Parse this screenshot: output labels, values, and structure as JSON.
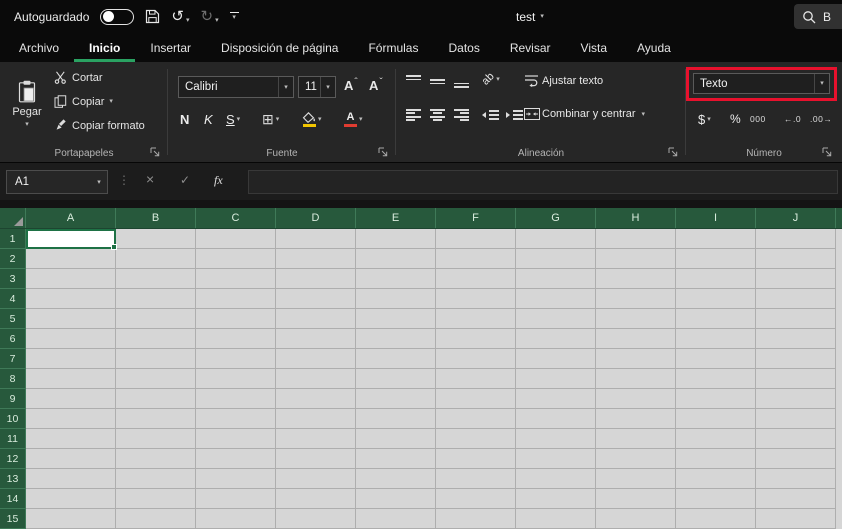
{
  "title_bar": {
    "autosave_label": "Autoguardado",
    "doc_title": "test",
    "search_text": "B"
  },
  "tabs": [
    {
      "label": "Archivo",
      "active": false
    },
    {
      "label": "Inicio",
      "active": true
    },
    {
      "label": "Insertar",
      "active": false
    },
    {
      "label": "Disposición de página",
      "active": false
    },
    {
      "label": "Fórmulas",
      "active": false
    },
    {
      "label": "Datos",
      "active": false
    },
    {
      "label": "Revisar",
      "active": false
    },
    {
      "label": "Vista",
      "active": false
    },
    {
      "label": "Ayuda",
      "active": false
    }
  ],
  "ribbon": {
    "clipboard": {
      "group_label": "Portapapeles",
      "paste_label": "Pegar",
      "cut_label": "Cortar",
      "copy_label": "Copiar",
      "format_painter_label": "Copiar formato"
    },
    "font": {
      "group_label": "Fuente",
      "font_name": "Calibri",
      "font_size": "11",
      "grow": "A",
      "shrink": "A",
      "bold": "N",
      "italic": "K",
      "underline": "S"
    },
    "alignment": {
      "group_label": "Alineación",
      "orientation_text": "ab",
      "wrap_label": "Ajustar texto",
      "merge_label": "Combinar y centrar"
    },
    "number": {
      "group_label": "Número",
      "format_value": "Texto",
      "currency": "$",
      "percent": "%",
      "thousands": "000",
      "increase_decimal": "←.0",
      "decrease_decimal": ".00→",
      "highlight_color": "#e8112d"
    }
  },
  "formula_bar": {
    "name_box": "A1",
    "cancel": "×",
    "enter": "✓",
    "fx": "fx"
  },
  "grid": {
    "columns": [
      "A",
      "B",
      "C",
      "D",
      "E",
      "F",
      "G",
      "H",
      "I",
      "J"
    ],
    "rows": [
      "1",
      "2",
      "3",
      "4",
      "5",
      "6",
      "7",
      "8",
      "9",
      "10",
      "11",
      "12",
      "13",
      "14",
      "15"
    ],
    "selected_cell": "A1"
  },
  "colors": {
    "excel_green": "#217346",
    "header_green": "#27593c",
    "selection_green": "#1e7145",
    "highlight_red": "#e8112d",
    "tab_underline_green": "#2aa262"
  },
  "icons": {
    "chevron_down": "▾",
    "caret_up": "ˆ",
    "caret_down": "ˇ",
    "undo": "↺",
    "redo": "↻",
    "dots": "⋮",
    "borders": "⊞"
  }
}
